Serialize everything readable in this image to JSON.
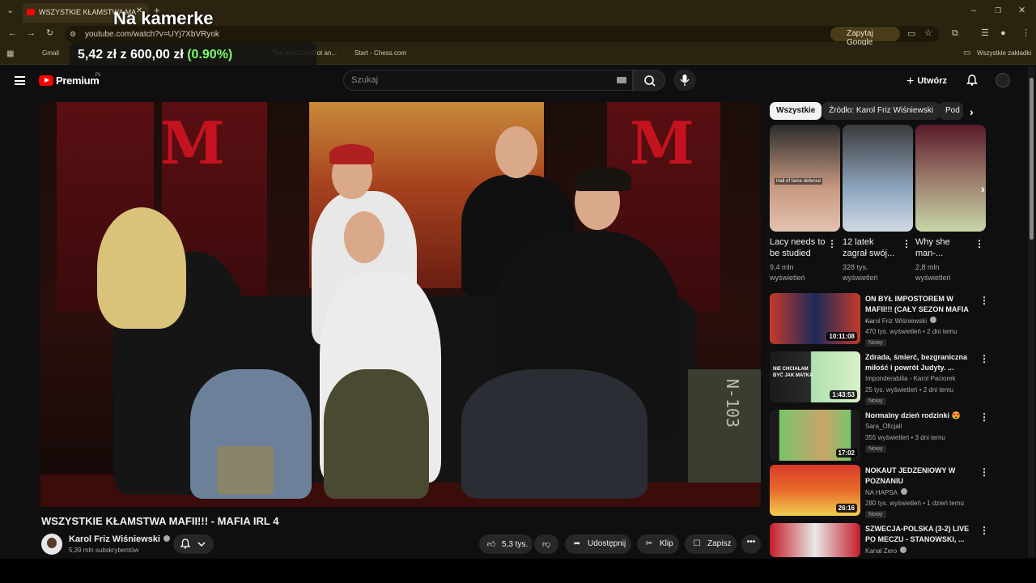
{
  "browser": {
    "tab_title": "WSZYSTKIE KŁAMSTWA MA",
    "url": "youtube.com/watch?v=UYj7XbVRyok",
    "ask_google": "Zapytaj Google",
    "bookmarks": [
      "Gmail",
      "The best ChatBot an...",
      "Start - Chess.com"
    ],
    "all_bookmarks": "Wszystkie zakładki"
  },
  "overlay": {
    "title": "Na kamerke",
    "amount": "5,42 zł",
    "separator": "z",
    "goal": "600,00 zł",
    "percent": "(0.90%)"
  },
  "youtube": {
    "logo_text": "Premium",
    "country": "PL",
    "search_placeholder": "Szukaj",
    "create_label": "Utwórz"
  },
  "video": {
    "title": "WSZYSTKIE KŁAMSTWA MAFII!!! - MAFIA IRL 4",
    "channel": "Karol Friz Wiśniewski",
    "subscribers": "5,39 mln subskrybentów",
    "likes": "5,3 tys.",
    "share": "Udostępnij",
    "clip": "Klip",
    "save": "Zapisz",
    "crate_text": "N-103"
  },
  "chips": [
    "Wszystkie",
    "Źródło: Karol Friz Wiśniewski",
    "Pod"
  ],
  "shorts": [
    {
      "title": "Lacy needs to be studied",
      "views": "9,4 mln wyświetleń",
      "overlay_text": "Hall of fame defense"
    },
    {
      "title": "12 latek zagrał swój...",
      "views": "328 tys. wyświetleń"
    },
    {
      "title": "Why she man-...",
      "views": "2,8 mln wyświetleń"
    }
  ],
  "recommended": [
    {
      "title": "ON BYŁ IMPOSTOREM W MAFII!!! (CAŁY SEZON MAFIA ...",
      "channel": "Karol Friz Wiśniewski",
      "verified": true,
      "meta": "470 tys. wyświetleń • 2 dni temu",
      "badge": "Nowy",
      "duration": "10:11:08"
    },
    {
      "title": "Zdrada, śmierć, bezgraniczna miłość i powrót Judyty. ...",
      "channel": "Imponderabilia - Karol Paciorek",
      "verified": false,
      "meta": "25 tys. wyświetleń • 2 dni temu",
      "badge": "Nowy",
      "duration": "1:43:53",
      "thumb_text": "NIE CHCIAŁAM BYĆ JAK MATKA"
    },
    {
      "title": "Normalny dzień rodzinki 😍",
      "channel": "Sara_Oficjall",
      "verified": false,
      "meta": "355 wyświetleń • 3 dni temu",
      "badge": "Nowy",
      "duration": "17:02"
    },
    {
      "title": "NOKAUT JEDZENIOWY W POZNANIU",
      "channel": "NA HAPSA",
      "verified": true,
      "meta": "280 tys. wyświetleń • 1 dzień temu",
      "badge": "Nowy",
      "duration": "26:16"
    },
    {
      "title": "SZWECJA-POLSKA (3-2) LIVE PO MECZU - STANOWSKI, ...",
      "channel": "Kanał Zero",
      "verified": true,
      "meta": "",
      "badge": "",
      "duration": ""
    }
  ],
  "colors": {
    "youtube_red": "#ff0000",
    "overlay_green": "#7cff6a",
    "background": "#0f0f0f"
  }
}
